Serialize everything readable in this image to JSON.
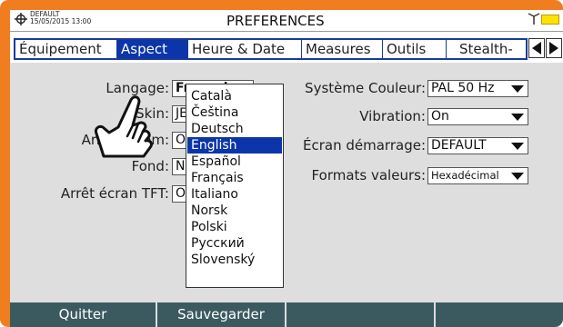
{
  "status": {
    "line1": "DEFAULT",
    "line2": "15/05/2015 13:00",
    "title": "PREFERENCES"
  },
  "tabs": [
    {
      "label": "Équipement",
      "active": false
    },
    {
      "label": "Aspect",
      "active": true
    },
    {
      "label": "Heure & Date",
      "active": false
    },
    {
      "label": "Measures",
      "active": false
    },
    {
      "label": "Outils",
      "active": false
    },
    {
      "label": "Stealth-",
      "active": false
    }
  ],
  "left": {
    "language_label": "Langage:",
    "language_value": "Français",
    "skin_label": "Skin:",
    "skin_value": "JE",
    "auto_off_label": "Arrêt Autom:",
    "auto_off_value": "Of",
    "background_label": "Fond:",
    "background_value": "No",
    "tft_off_label": "Arrêt écran TFT:",
    "tft_off_value": "Of"
  },
  "right": {
    "color_system_label": "Système Couleur:",
    "color_system_value": "PAL 50 Hz",
    "vibration_label": "Vibration:",
    "vibration_value": "On",
    "startup_screen_label": "Écran démarrage:",
    "startup_screen_value": "DEFAULT",
    "value_formats_label": "Formats valeurs:",
    "value_formats_value": "Hexadécimal"
  },
  "language_dropdown": {
    "options": [
      "Català",
      "Čeština",
      "Deutsch",
      "English",
      "Español",
      "Français",
      "Italiano",
      "Norsk",
      "Polski",
      "Русский",
      "Slovenský"
    ],
    "highlighted": "English"
  },
  "footer": {
    "quit": "Quitter",
    "save": "Sauvegarder",
    "f3": "",
    "f4": "",
    "f5": ""
  },
  "colors": {
    "frame": "#f07d1f",
    "accent": "#0b35a8",
    "footer": "#3b5a60",
    "battery": "#ffe200"
  },
  "icons": [
    "settings-icon",
    "antenna-icon",
    "battery-icon",
    "arrow-left-icon",
    "arrow-right-icon",
    "hand-pointer-icon"
  ]
}
